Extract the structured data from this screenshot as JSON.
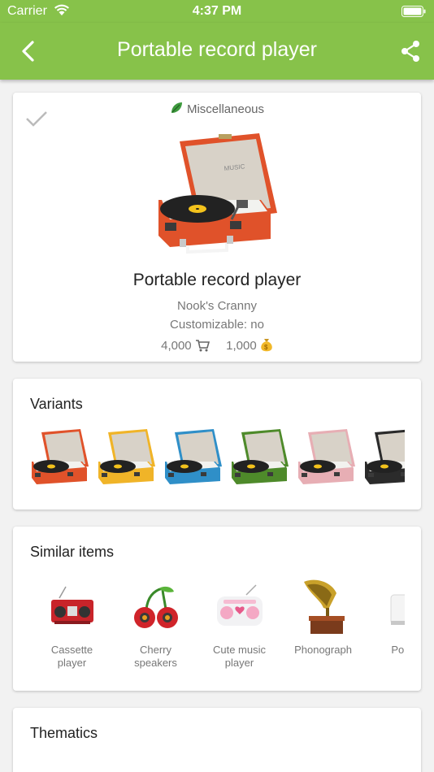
{
  "status": {
    "carrier": "Carrier",
    "time": "4:37 PM"
  },
  "appbar": {
    "title": "Portable record player"
  },
  "item": {
    "category": "Miscellaneous",
    "name": "Portable record player",
    "source": "Nook's Cranny",
    "customizable": "Customizable: no",
    "buy_price": "4,000",
    "sell_price": "1,000"
  },
  "variants": {
    "title": "Variants",
    "colors": [
      "#e0522a",
      "#f0b428",
      "#2f8fc8",
      "#4e8a2a",
      "#e7aeb4",
      "#2b2b2b"
    ]
  },
  "similar": {
    "title": "Similar items",
    "items": [
      {
        "label": "Cassette player",
        "icon": "cassette-player-icon"
      },
      {
        "label": "Cherry speakers",
        "icon": "cherry-speakers-icon"
      },
      {
        "label": "Cute music player",
        "icon": "cute-music-player-icon"
      },
      {
        "label": "Phonograph",
        "icon": "phonograph-icon"
      },
      {
        "label": "Portab",
        "icon": "portable-radio-icon"
      }
    ]
  },
  "thematics": {
    "title": "Thematics"
  }
}
